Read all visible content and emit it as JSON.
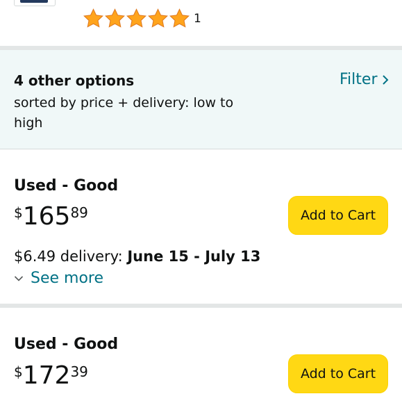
{
  "product": {
    "rating_stars": 5,
    "rating_count": "1"
  },
  "options": {
    "title": "4 other options",
    "subtitle": "sorted by price + delivery: low to high",
    "filter_label": "Filter"
  },
  "offers": [
    {
      "condition": "Used - Good",
      "price_symbol": "$",
      "price_whole": "165",
      "price_fraction": "89",
      "button_label": "Add to Cart",
      "delivery_cost": "$6.49 delivery: ",
      "delivery_dates": "June 15 - July 13",
      "see_more": "See more"
    },
    {
      "condition": "Used - Good",
      "price_symbol": "$",
      "price_whole": "172",
      "price_fraction": "39",
      "button_label": "Add to Cart"
    }
  ],
  "colors": {
    "star": "#ffa41c",
    "link": "#007185",
    "button": "#ffd814",
    "panel": "#f0f8f8"
  }
}
